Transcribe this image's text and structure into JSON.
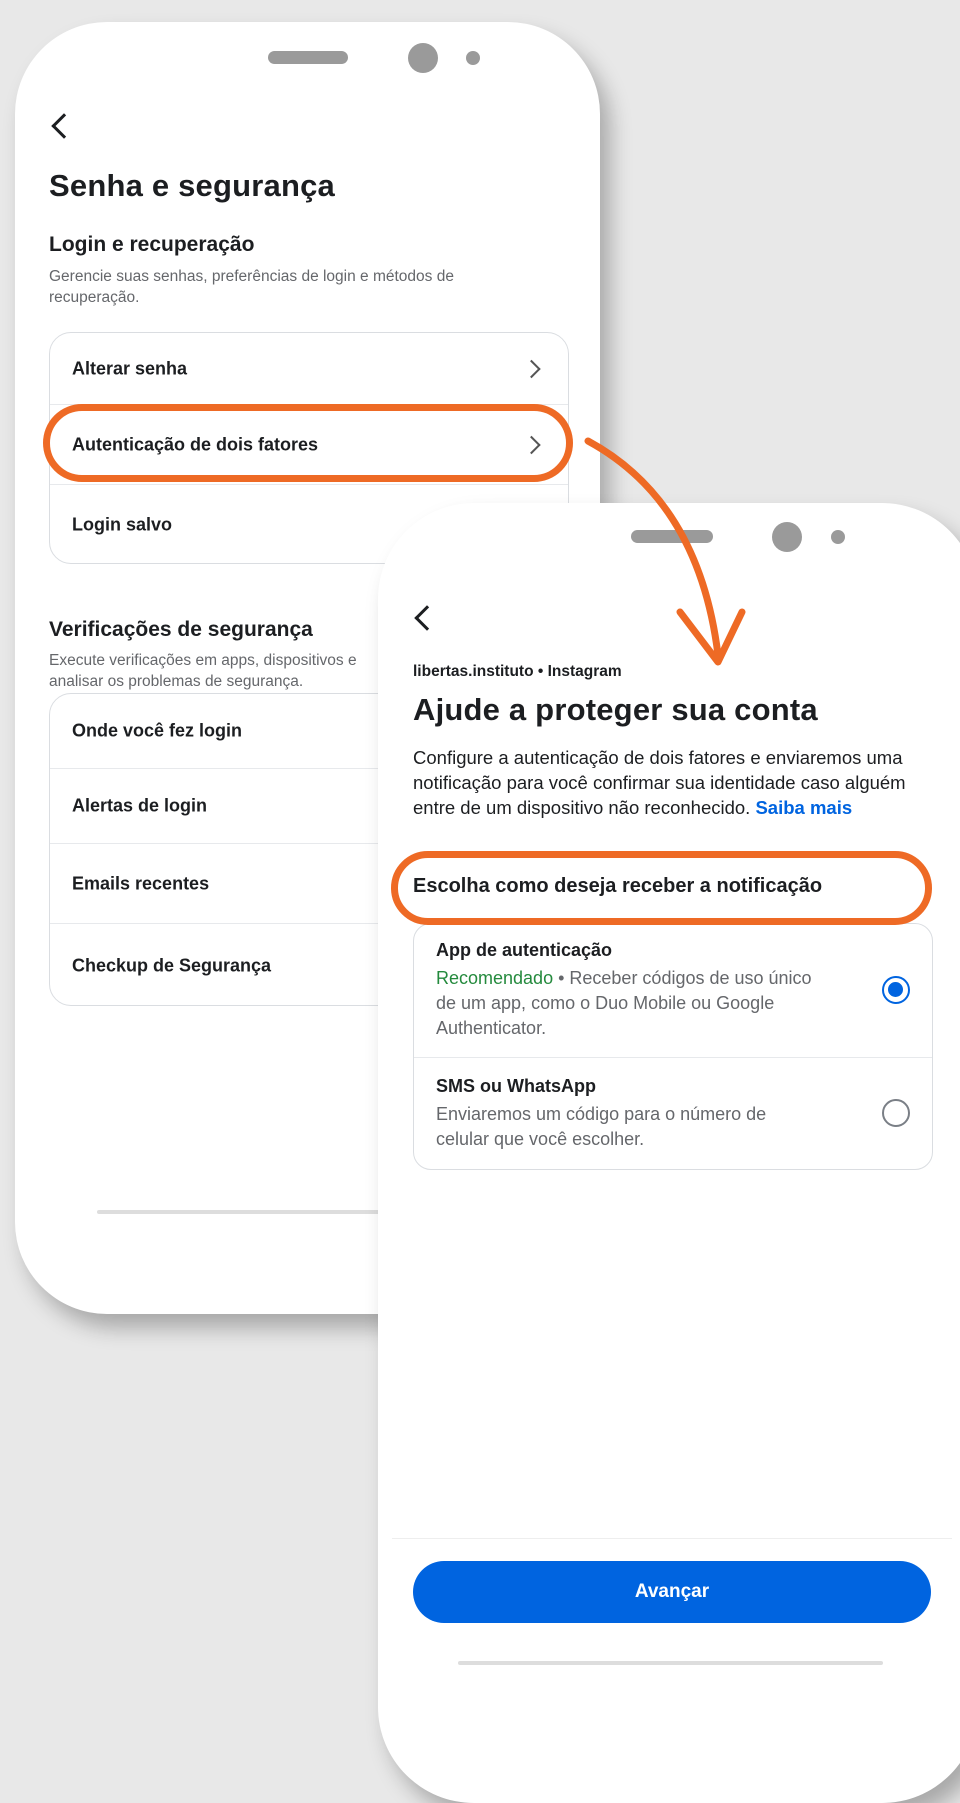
{
  "screen1": {
    "title": "Senha e segurança",
    "login_section": {
      "heading": "Login e recuperação",
      "description": "Gerencie suas senhas, preferências de login e métodos de recuperação.",
      "items": [
        "Alterar senha",
        "Autenticação de dois fatores",
        "Login salvo"
      ]
    },
    "checks_section": {
      "heading": "Verificações de segurança",
      "description": "Execute verificações em apps, dispositivos e analisar os problemas de segurança.",
      "items": [
        "Onde você fez login",
        "Alertas de login",
        "Emails recentes",
        "Checkup de Segurança"
      ]
    }
  },
  "screen2": {
    "account_line": "libertas.instituto • Instagram",
    "title": "Ajude a proteger sua conta",
    "description": "Configure a autenticação de dois fatores e enviaremos uma notificação para você confirmar sua identidade caso alguém entre de um dispositivo não reconhecido.",
    "learn_more": "Saiba mais",
    "choose_label": "Escolha como deseja receber a notificação",
    "options": [
      {
        "title": "App de autenticação",
        "badge": "Recomendado",
        "description": " • Receber códigos de uso único de um app, como o Duo Mobile ou Google Authenticator.",
        "selected": true
      },
      {
        "title": "SMS ou WhatsApp",
        "description": "Enviaremos um código para o número de celular que você escolher.",
        "selected": false
      }
    ],
    "next_button": "Avançar"
  },
  "colors": {
    "highlight": "#ee6a25",
    "primary": "#0064e0",
    "recommended": "#248a3d"
  }
}
